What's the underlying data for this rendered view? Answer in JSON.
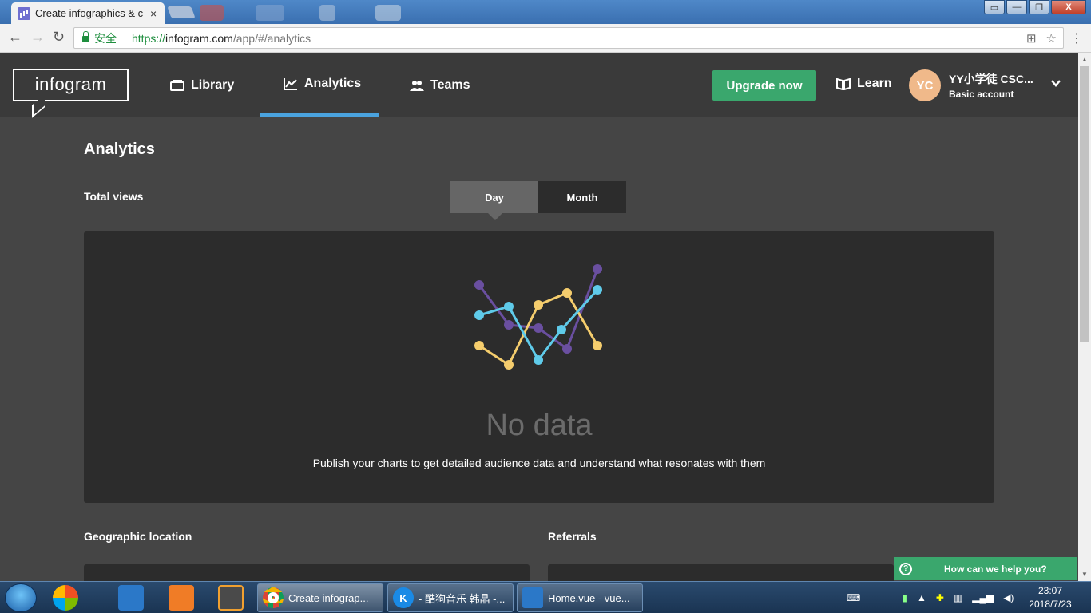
{
  "browser": {
    "tab_title": "Create infographics & c",
    "tab_close": "×",
    "secure_label": "安全",
    "url_scheme": "https://",
    "url_host": "infogram.com",
    "url_path": "/app/#/analytics",
    "back": "←",
    "forward": "→",
    "reload": "↻",
    "menu": "⋮",
    "star": "☆",
    "translate": "⊞",
    "window_buttons": [
      "▭",
      "—",
      "❐",
      "X"
    ]
  },
  "app": {
    "logo": "infogram",
    "nav": [
      {
        "label": "Library",
        "icon": "library-icon"
      },
      {
        "label": "Analytics",
        "icon": "analytics-icon",
        "active": true
      },
      {
        "label": "Teams",
        "icon": "teams-icon"
      }
    ],
    "upgrade_label": "Upgrade now",
    "learn_label": "Learn",
    "user": {
      "initials": "YC",
      "name": "YY小学徒 CSC...",
      "plan": "Basic account"
    }
  },
  "content": {
    "title": "Analytics",
    "total_views_label": "Total views",
    "toggle": {
      "day": "Day",
      "month": "Month",
      "selected": "Day"
    },
    "nodata_title": "No data",
    "nodata_text": "Publish your charts to get detailed audience data and understand what resonates with them",
    "geo_label": "Geographic location",
    "referrals_label": "Referrals"
  },
  "help": {
    "label": "How can we help you?",
    "icon": "?"
  },
  "taskbar": {
    "tasks": [
      {
        "label": "Create infograp...",
        "icon": "chrome-icon"
      },
      {
        "label": "- 酷狗音乐 韩晶 -...",
        "icon": "kugou-icon",
        "glyph": "K"
      },
      {
        "label": "Home.vue - vue...",
        "icon": "vscode-icon"
      }
    ],
    "time": "23:07",
    "date": "2018/7/23"
  },
  "colors": {
    "accent_green": "#3aa76d",
    "accent_blue": "#4aa3df",
    "line_purple": "#6a4fa0",
    "line_yellow": "#f5cd6d",
    "line_cyan": "#5fcbea"
  }
}
